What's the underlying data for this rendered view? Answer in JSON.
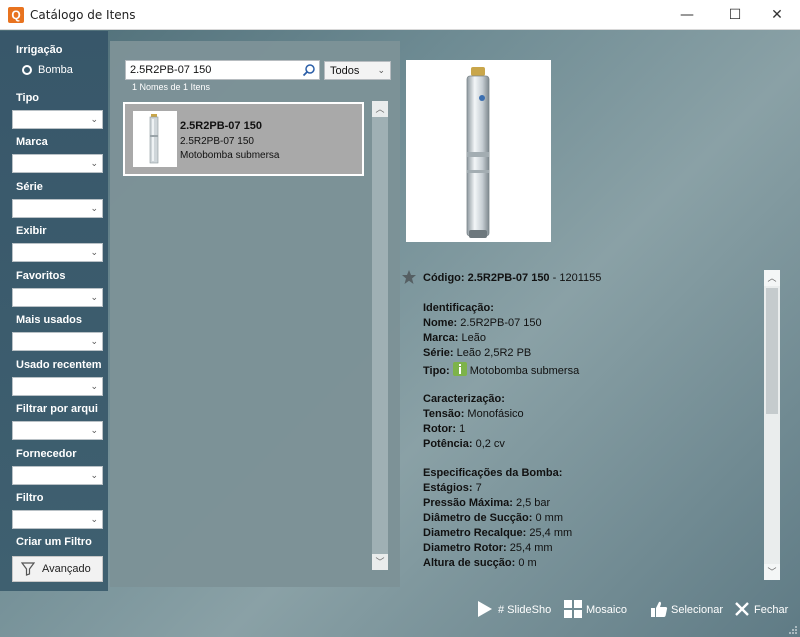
{
  "window": {
    "title": "Catálogo de Itens",
    "controls": {
      "minimize": "—",
      "maximize": "☐",
      "close": "✕"
    }
  },
  "sidebar": {
    "heading": "Irrigação",
    "radio_label": "Bomba",
    "filters": [
      {
        "label": "Tipo",
        "value": ""
      },
      {
        "label": "Marca",
        "value": ""
      },
      {
        "label": "Série",
        "value": ""
      },
      {
        "label": "Exibir",
        "value": ""
      },
      {
        "label": "Favoritos",
        "value": ""
      },
      {
        "label": "Mais usados",
        "value": ""
      },
      {
        "label": "Usado recentem",
        "value": ""
      },
      {
        "label": "Filtrar por arqui",
        "value": ""
      },
      {
        "label": "Fornecedor",
        "value": ""
      },
      {
        "label": "Filtro",
        "value": ""
      }
    ],
    "create_filter_label": "Criar um Filtro",
    "advanced_button": "Avançado"
  },
  "search": {
    "value": "2.5R2PB-07 150",
    "dropdown": "Todos",
    "count_text": "1 Nomes de 1 Itens"
  },
  "results": [
    {
      "title": "2.5R2PB-07 150",
      "code": "2.5R2PB-07 150",
      "description": "Motobomba submersa"
    }
  ],
  "details": {
    "codigo_label": "Código:",
    "codigo_value": "2.5R2PB-07 150",
    "codigo_suffix": "- 1201155",
    "identificacao": {
      "heading": "Identificação:",
      "nome_label": "Nome:",
      "nome": "2.5R2PB-07 150",
      "marca_label": "Marca:",
      "marca": "Leão",
      "serie_label": "Série:",
      "serie": "Leão 2,5R2 PB",
      "tipo_label": "Tipo:",
      "tipo": "Motobomba submersa"
    },
    "caracterizacao": {
      "heading": "Caracterização:",
      "tensao_label": "Tensão:",
      "tensao": "Monofásico",
      "rotor_label": "Rotor:",
      "rotor": "1",
      "potencia_label": "Potência:",
      "potencia": "0,2 cv"
    },
    "especificacoes": {
      "heading": "Especificações da Bomba:",
      "estagios_label": "Estágios:",
      "estagios": "7",
      "pressao_label": "Pressão Máxima:",
      "pressao": "2,5 bar",
      "succao_label": "Diâmetro de Sucção:",
      "succao": "0 mm",
      "recalque_label": "Diametro Recalque:",
      "recalque": "25,4 mm",
      "rotor_diam_label": "Diametro Rotor:",
      "rotor_diam": "25,4 mm",
      "altura_label": "Altura de sucção:",
      "altura": "0 m"
    }
  },
  "footer": {
    "slideshow": "# SlideSho",
    "mosaico": "Mosaico",
    "selecionar": "Selecionar",
    "fechar": "Fechar"
  },
  "colors": {
    "accent_orange": "#e8731f",
    "sidebar_bg": "#3a5a6b",
    "panel_bg": "#7c9297",
    "tipo_icon": "#7db34a"
  }
}
